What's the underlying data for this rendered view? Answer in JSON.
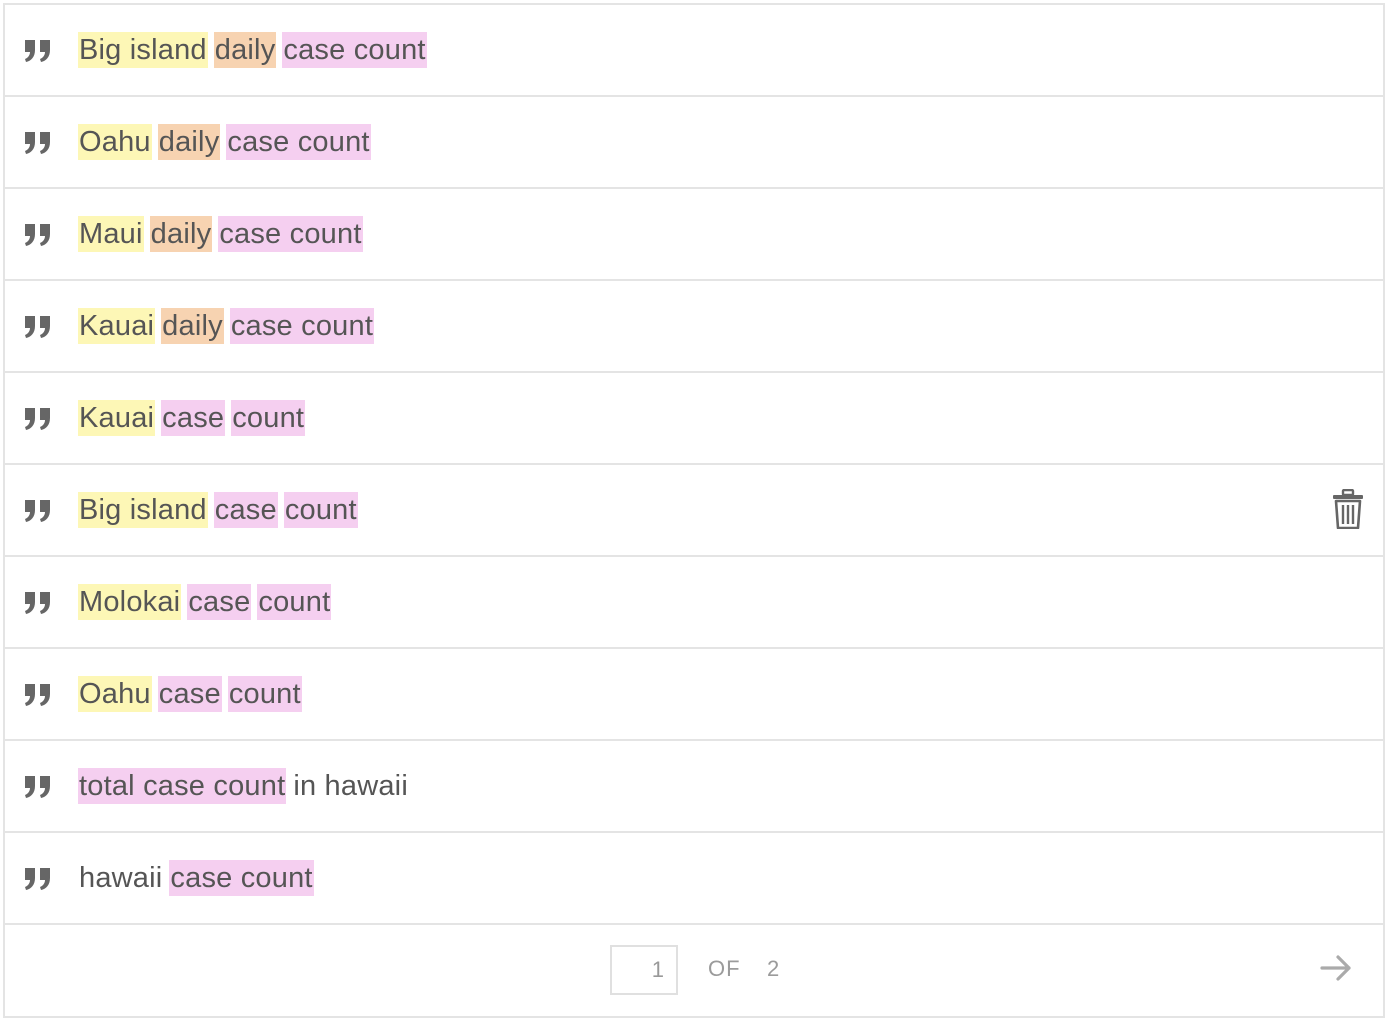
{
  "suggestions": [
    {
      "segments": [
        {
          "text": "Big island",
          "type": "location"
        },
        {
          "text": "daily",
          "type": "frequency"
        },
        {
          "text": "case count",
          "type": "metric"
        }
      ],
      "show_delete": false
    },
    {
      "segments": [
        {
          "text": "Oahu",
          "type": "location"
        },
        {
          "text": "daily",
          "type": "frequency"
        },
        {
          "text": "case count",
          "type": "metric"
        }
      ],
      "show_delete": false
    },
    {
      "segments": [
        {
          "text": "Maui",
          "type": "location"
        },
        {
          "text": "daily",
          "type": "frequency"
        },
        {
          "text": "case count",
          "type": "metric"
        }
      ],
      "show_delete": false
    },
    {
      "segments": [
        {
          "text": "Kauai",
          "type": "location"
        },
        {
          "text": "daily",
          "type": "frequency"
        },
        {
          "text": "case count",
          "type": "metric"
        }
      ],
      "show_delete": false
    },
    {
      "segments": [
        {
          "text": "Kauai",
          "type": "location"
        },
        {
          "text": "case",
          "type": "metric"
        },
        {
          "text": "count",
          "type": "metric"
        }
      ],
      "show_delete": false
    },
    {
      "segments": [
        {
          "text": "Big island",
          "type": "location"
        },
        {
          "text": "case",
          "type": "metric"
        },
        {
          "text": "count",
          "type": "metric"
        }
      ],
      "show_delete": true
    },
    {
      "segments": [
        {
          "text": "Molokai",
          "type": "location"
        },
        {
          "text": "case",
          "type": "metric"
        },
        {
          "text": "count",
          "type": "metric"
        }
      ],
      "show_delete": false
    },
    {
      "segments": [
        {
          "text": "Oahu",
          "type": "location"
        },
        {
          "text": "case",
          "type": "metric"
        },
        {
          "text": "count",
          "type": "metric"
        }
      ],
      "show_delete": false
    },
    {
      "segments": [
        {
          "text": "total case count",
          "type": "metric"
        },
        {
          "text": "in hawaii",
          "type": "plain"
        }
      ],
      "show_delete": false
    },
    {
      "segments": [
        {
          "text": "hawaii",
          "type": "plain"
        },
        {
          "text": "case count",
          "type": "metric"
        }
      ],
      "show_delete": false
    }
  ],
  "icons": {
    "row_icon": "quote-icon",
    "delete_icon": "trash-icon",
    "next_icon": "arrow-right-icon"
  },
  "pagination": {
    "current_page": "1",
    "of_label": "OF",
    "total_pages": "2"
  },
  "colors": {
    "location": "#fdf7b6",
    "frequency": "#f7d3b1",
    "metric": "#f5cff0",
    "border": "#e4e4e4",
    "icon": "#666666"
  }
}
